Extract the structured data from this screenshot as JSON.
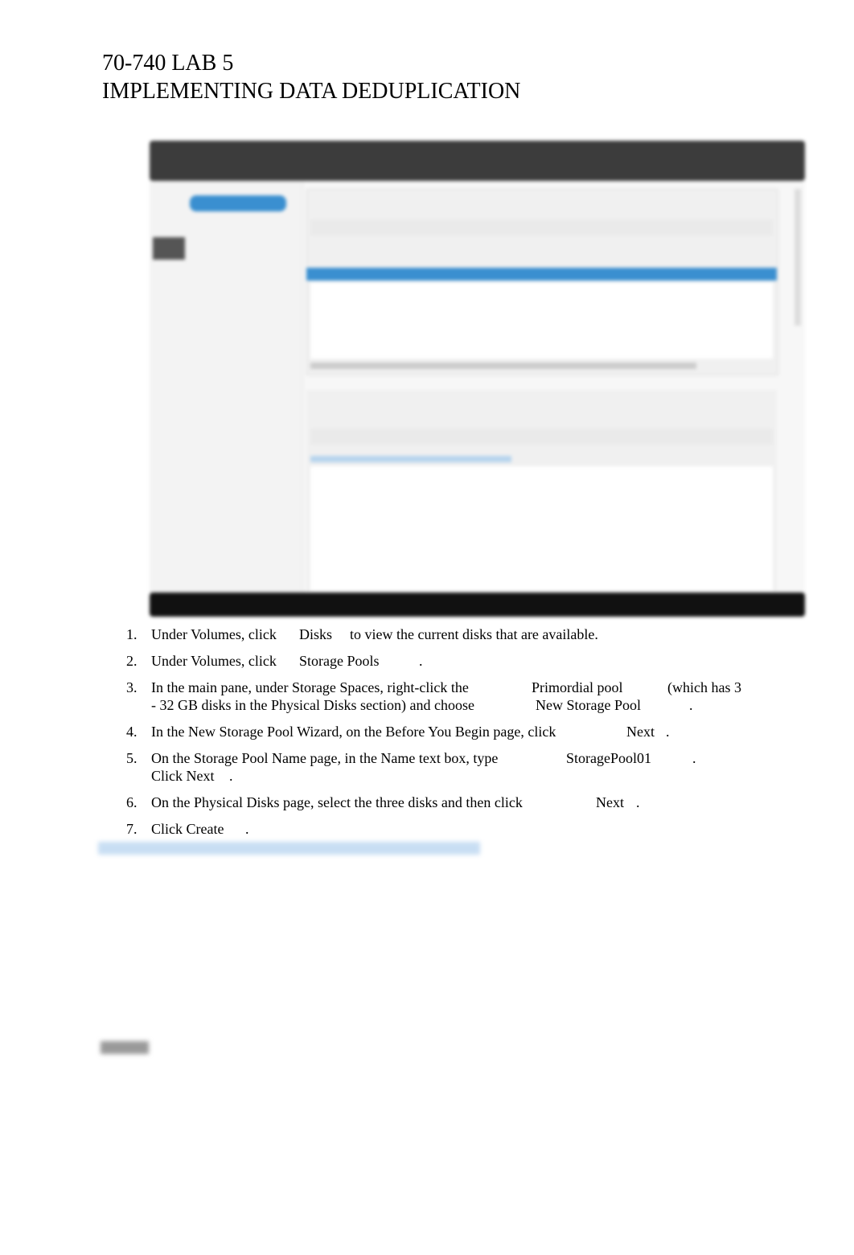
{
  "header": {
    "line1": "70-740 LAB 5",
    "line2": "IMPLEMENTING DATA DEDUPLICATION"
  },
  "steps": [
    {
      "num": "1.",
      "lines": [
        [
          "Under Volumes, click",
          "Disks",
          "to view the current disks that are available."
        ]
      ]
    },
    {
      "num": "2.",
      "lines": [
        [
          "Under Volumes, click",
          "Storage Pools",
          "."
        ]
      ]
    },
    {
      "num": "3.",
      "lines": [
        [
          "In the main pane, under Storage Spaces, right-click the",
          "Primordial pool",
          "(which has 3"
        ],
        [
          "- 32 GB disks in the Physical Disks section) and choose",
          "New Storage Pool",
          "."
        ]
      ]
    },
    {
      "num": "4.",
      "lines": [
        [
          "In the New Storage Pool Wizard, on the Before You Begin page, click",
          "Next",
          "."
        ]
      ]
    },
    {
      "num": "5.",
      "lines": [
        [
          "On the Storage Pool Name page, in the Name text box, type",
          "StoragePool01",
          "."
        ],
        [
          "Click Next",
          "."
        ]
      ]
    },
    {
      "num": "6.",
      "lines": [
        [
          "On the Physical Disks page, select the three disks and then click",
          "Next",
          "."
        ]
      ]
    },
    {
      "num": "7.",
      "lines": [
        [
          "Click Create",
          "."
        ]
      ]
    }
  ],
  "colors": {
    "accent": "#3a8fd0",
    "titlebar": "#3c3c3c",
    "taskbar": "#111111"
  }
}
